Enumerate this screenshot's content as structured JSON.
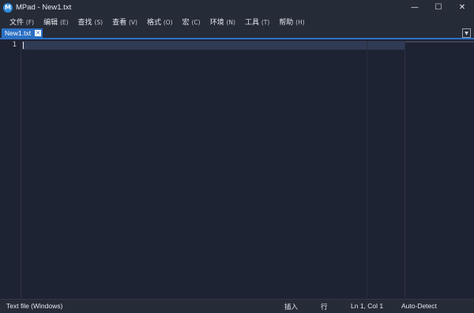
{
  "window": {
    "title": "MPad - New1.txt",
    "logo_letter": "M",
    "minimize": "—",
    "maximize": "☐",
    "close": "✕"
  },
  "menu": [
    {
      "label": "文件",
      "accel": "(F)"
    },
    {
      "label": "编辑",
      "accel": "(E)"
    },
    {
      "label": "查找",
      "accel": "(S)"
    },
    {
      "label": "查看",
      "accel": "(V)"
    },
    {
      "label": "格式",
      "accel": "(O)"
    },
    {
      "label": "宏",
      "accel": "(C)"
    },
    {
      "label": "环境",
      "accel": "(N)"
    },
    {
      "label": "工具",
      "accel": "(T)"
    },
    {
      "label": "帮助",
      "accel": "(H)"
    }
  ],
  "tabs": {
    "active_label": "New1.txt",
    "close_glyph": "✕",
    "dropdown_glyph": "▼"
  },
  "editor": {
    "line_numbers": [
      "1"
    ]
  },
  "status": {
    "file_type": "Text file (Windows)",
    "insert_mode": "插入",
    "line_mode": "行",
    "position": "Ln 1, Col 1",
    "encoding": "Auto-Detect"
  }
}
